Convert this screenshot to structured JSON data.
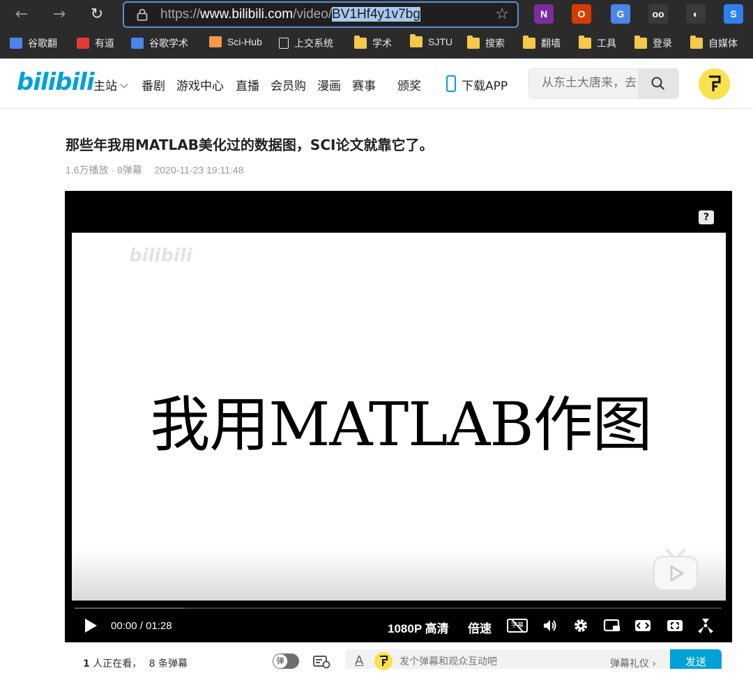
{
  "browser": {
    "back_icon": "←",
    "forward_icon": "→",
    "reload_icon": "↻",
    "url_scheme": "https://",
    "url_host": "www.bilibili.com",
    "url_path": "/video/",
    "url_id": "BV1Hf4y1v7bg",
    "star_icon": "☆",
    "extensions": [
      {
        "name": "onenote-icon",
        "glyph": "N",
        "color": "#7a2e9c"
      },
      {
        "name": "office-icon",
        "glyph": "O",
        "color": "#d83b01"
      },
      {
        "name": "google-translate-icon",
        "glyph": "G",
        "color": "#4a86e8"
      },
      {
        "name": "glasses-icon",
        "glyph": "oo",
        "color": "#3a3a3a"
      },
      {
        "name": "mouse-icon",
        "glyph": "◐",
        "color": "#3a3a3a"
      },
      {
        "name": "s-extension-icon",
        "glyph": "S",
        "color": "#2f80ed"
      }
    ]
  },
  "bookmarks": [
    {
      "label": "谷歌翻",
      "icon": "google-translate-icon",
      "color": "#4a86e8"
    },
    {
      "label": "有道",
      "icon": "youdao-icon",
      "color": "#e53935"
    },
    {
      "label": "谷歌学术",
      "icon": "scholar-icon",
      "color": "#4a86e8"
    },
    {
      "label": "Sci-Hub",
      "icon": "scihub-icon",
      "color": "#f2994a"
    },
    {
      "label": "上交系统",
      "icon": "page-icon",
      "color": "#e8e8e8"
    },
    {
      "label": "学术",
      "icon": "folder-icon",
      "color": "#f2c94c"
    },
    {
      "label": "SJTU",
      "icon": "folder-icon",
      "color": "#f2c94c"
    },
    {
      "label": "搜索",
      "icon": "folder-icon",
      "color": "#f2c94c"
    },
    {
      "label": "翻墙",
      "icon": "folder-icon",
      "color": "#f2c94c"
    },
    {
      "label": "工具",
      "icon": "folder-icon",
      "color": "#f2c94c"
    },
    {
      "label": "登录",
      "icon": "folder-icon",
      "color": "#f2c94c"
    },
    {
      "label": "自媒体",
      "icon": "folder-icon",
      "color": "#f2c94c"
    }
  ],
  "header": {
    "logo": "bilibili",
    "nav": [
      "主站",
      "番剧",
      "游戏中心",
      "直播",
      "会员购",
      "漫画",
      "赛事",
      "颁奖"
    ],
    "download": "下载APP",
    "search_placeholder": "从东土大唐来，去"
  },
  "video": {
    "title": "那些年我用MATLAB美化过的数据图，SCI论文就靠它了。",
    "plays": "1.6万播放",
    "danmaku_count": "8弹幕",
    "date": "2020-11-23 19:11:48",
    "caption": "我用MATLAB作图",
    "watermark": "bilibili",
    "help": "?",
    "progress": 0.17
  },
  "controls": {
    "current_time": "00:00",
    "separator": "/",
    "duration": "01:28",
    "quality": "1080P 高清",
    "speed": "倍速",
    "subtitle": "字幕"
  },
  "danmaku_bar": {
    "viewers_count": "1",
    "viewers_text": "人正在看，",
    "danmaku_count": "8",
    "danmaku_text": "条弹幕",
    "toggle_label": "弹",
    "font_icon": "A",
    "placeholder": "发个弹幕和观众互动吧",
    "etiquette": "弹幕礼仪 ›",
    "send": "发送"
  },
  "colors": {
    "accent": "#00a1d6",
    "url_highlight": "#a9c8f0",
    "browser_bg": "#2b2b2b",
    "avatar": "#fbe14b"
  }
}
